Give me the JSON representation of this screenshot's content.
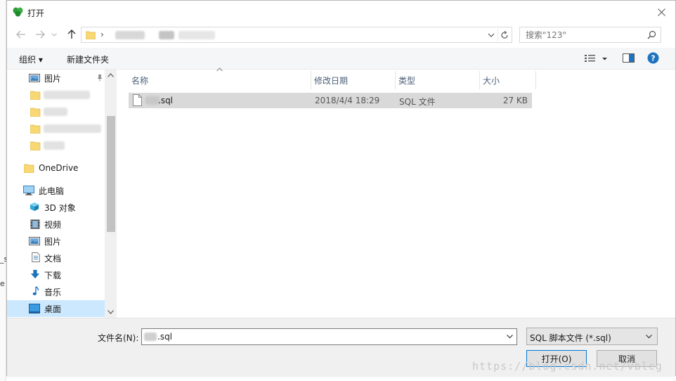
{
  "window": {
    "title": "打开",
    "icon": "app-leaf-icon",
    "close_icon": "close-icon"
  },
  "address": {
    "separator": "›",
    "search_placeholder": "搜索\"123\""
  },
  "toolbar": {
    "organize_label": "组织 ▾",
    "new_folder_label": "新建文件夹"
  },
  "nav": {
    "quick_access_pictures": "图片",
    "onedrive": "OneDrive",
    "this_pc": "此电脑",
    "objects_3d": "3D 对象",
    "videos": "视频",
    "pictures": "图片",
    "documents": "文档",
    "downloads": "下载",
    "music": "音乐",
    "desktop": "桌面"
  },
  "columns": {
    "name": "名称",
    "modified": "修改日期",
    "type": "类型",
    "size": "大小"
  },
  "files": [
    {
      "name": ".sql",
      "modified": "2018/4/4 18:29",
      "type": "SQL 文件",
      "size": "27 KB"
    }
  ],
  "bottom": {
    "filename_label": "文件名(N):",
    "filename_value": ".sql",
    "filetype_value": "SQL 脚本文件 (*.sql)",
    "open_button": "打开(O)",
    "cancel_button": "取消"
  },
  "watermark": "https://blog.csdn.net/vblcg",
  "background_fragments": [
    "_s",
    "e"
  ],
  "colors": {
    "accent": "#0078d7",
    "selected_row": "#d9d9d9",
    "nav_selected": "#cce8ff",
    "folder": "#f8d775"
  }
}
